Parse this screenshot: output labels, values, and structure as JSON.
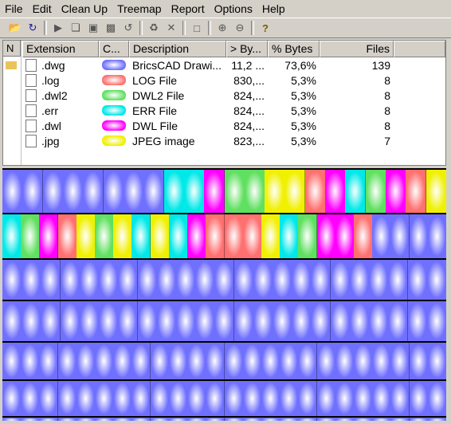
{
  "menu": [
    "File",
    "Edit",
    "Clean Up",
    "Treemap",
    "Report",
    "Options",
    "Help"
  ],
  "toolbar": {
    "icons": [
      "open-icon",
      "refresh-icon",
      "play-icon",
      "copy-icon",
      "explorer-icon",
      "cmd-icon",
      "refresh-all-icon",
      "recycle-icon",
      "delete-icon",
      "properties-icon",
      "zoom-in-icon",
      "zoom-out-icon",
      "help-icon"
    ]
  },
  "list": {
    "left_header": "N",
    "columns": {
      "extension": "Extension",
      "color": "C...",
      "description": "Description",
      "bytes": "> By...",
      "pct": "% Bytes",
      "files": "Files"
    },
    "rows": [
      {
        "ext": ".dwg",
        "color": "#7070ff",
        "desc": "BricsCAD Drawi...",
        "bytes": "11,2 ...",
        "pct": "73,6%",
        "files": "139",
        "icon": "bricscad-icon"
      },
      {
        "ext": ".log",
        "color": "#ff7070",
        "desc": "LOG File",
        "bytes": "830,...",
        "pct": "5,3%",
        "files": "8",
        "icon": "log-file-icon"
      },
      {
        "ext": ".dwl2",
        "color": "#60e060",
        "desc": "DWL2 File",
        "bytes": "824,...",
        "pct": "5,3%",
        "files": "8",
        "icon": "blank-file-icon"
      },
      {
        "ext": ".err",
        "color": "#00e8e8",
        "desc": "ERR File",
        "bytes": "824,...",
        "pct": "5,3%",
        "files": "8",
        "icon": "err-file-icon"
      },
      {
        "ext": ".dwl",
        "color": "#ff00ff",
        "desc": "DWL File",
        "bytes": "824,...",
        "pct": "5,3%",
        "files": "8",
        "icon": "blank-file-icon"
      },
      {
        "ext": ".jpg",
        "color": "#f0f000",
        "desc": "JPEG image",
        "bytes": "823,...",
        "pct": "5,3%",
        "files": "7",
        "icon": "image-file-icon"
      }
    ]
  },
  "treemap": {
    "palette": {
      "dwg": "#7070ff",
      "log": "#ff7070",
      "dwl2": "#60e060",
      "err": "#00e8e8",
      "dwl": "#ff00ff",
      "jpg": "#f0f000"
    },
    "row1": [
      "dwg",
      "dwg",
      "dwg",
      "dwg",
      "dwg",
      "dwg",
      "dwg",
      "dwg",
      "err",
      "err",
      "dwl",
      "dwl2",
      "dwl2",
      "jpg",
      "jpg",
      "log",
      "dwl",
      "err",
      "dwl2",
      "dwl",
      "log",
      "jpg"
    ],
    "row2": [
      "err",
      "dwl2",
      "dwl",
      "log",
      "jpg",
      "dwl2",
      "jpg",
      "err",
      "jpg",
      "err",
      "dwl",
      "log",
      "log",
      "log",
      "jpg",
      "err",
      "dwl2",
      "dwl",
      "dwl",
      "log",
      "dwg",
      "dwg",
      "dwg",
      "dwg"
    ]
  }
}
